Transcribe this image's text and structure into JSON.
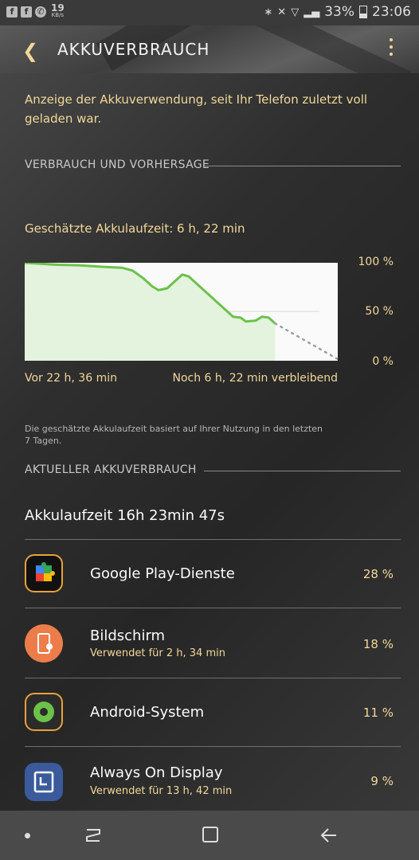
{
  "status_bar": {
    "net_speed_value": "19",
    "net_speed_unit": "KB/s",
    "battery_percent": "33%",
    "time": "23:06"
  },
  "header": {
    "title": "AKKUVERBRAUCH"
  },
  "description": "Anzeige der Akkuverwendung, seit Ihr Telefon zuletzt voll geladen war.",
  "section_usage": "VERBRAUCH UND VORHERSAGE",
  "estimate": "Geschätzte Akkulaufzeit: 6 h, 22 min",
  "chart_data": {
    "type": "area",
    "y_labels": [
      "100 %",
      "50 %",
      "0 %"
    ],
    "x_start_label": "Vor 22 h, 36 min",
    "x_end_label": "Noch 6 h, 22 min verbleibend",
    "ylim": [
      0,
      100
    ],
    "points": [
      [
        0,
        100
      ],
      [
        1.5,
        99
      ],
      [
        3,
        98
      ],
      [
        5,
        97.5
      ],
      [
        7,
        96
      ],
      [
        9,
        95
      ],
      [
        10,
        92
      ],
      [
        11,
        84
      ],
      [
        11.8,
        76
      ],
      [
        12.4,
        72
      ],
      [
        13.2,
        74
      ],
      [
        14,
        82
      ],
      [
        14.6,
        88
      ],
      [
        15.2,
        86
      ],
      [
        16,
        78
      ],
      [
        17,
        68
      ],
      [
        18,
        58
      ],
      [
        18.8,
        50
      ],
      [
        19.3,
        45
      ],
      [
        20,
        44
      ],
      [
        20.5,
        40
      ],
      [
        21.4,
        41
      ],
      [
        22,
        45
      ],
      [
        22.6,
        44
      ],
      [
        23.2,
        38
      ]
    ],
    "forecast": [
      [
        23.2,
        38
      ],
      [
        29,
        0
      ]
    ],
    "x_range": [
      0,
      29
    ],
    "accent": "#6cc14a",
    "forecast_color": "#9aa0a6"
  },
  "chart_note": "Die geschätzte Akkulaufzeit basiert auf Ihrer Nutzung in den letzten 7 Tagen.",
  "section_current": "AKTUELLER AKKUVERBRAUCH",
  "uptime": "Akkulaufzeit 16h 23min 47s",
  "apps": [
    {
      "name": "Google Play-Dienste",
      "sub": "",
      "pct": "28 %",
      "icon": "google-play-services-icon"
    },
    {
      "name": "Bildschirm",
      "sub": "Verwendet für 2 h, 34 min",
      "pct": "18 %",
      "icon": "screen-icon"
    },
    {
      "name": "Android-System",
      "sub": "",
      "pct": "11 %",
      "icon": "android-system-gear-icon"
    },
    {
      "name": "Always On Display",
      "sub": "Verwendet für 13 h, 42 min",
      "pct": "9 %",
      "icon": "always-on-display-icon"
    }
  ],
  "colors": {
    "accent": "#f2d79a",
    "graph": "#6cc14a"
  }
}
